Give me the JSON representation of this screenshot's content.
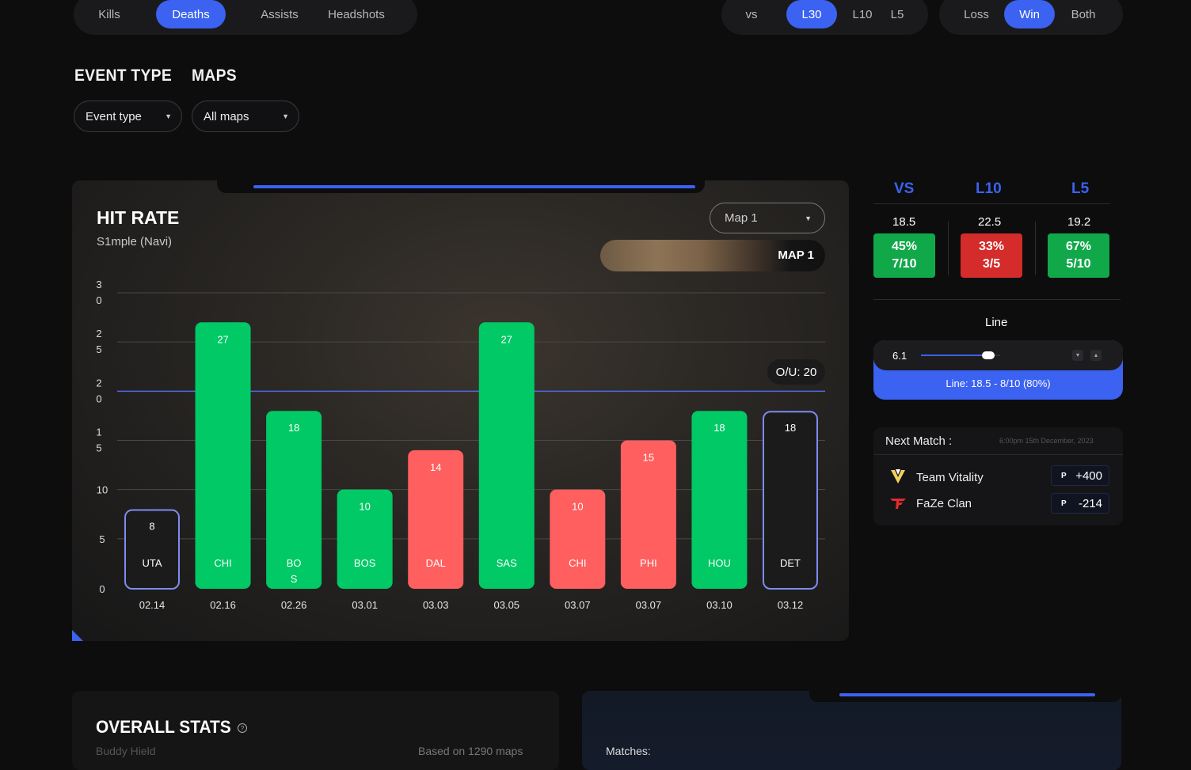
{
  "tabs": {
    "stat": [
      {
        "label": "Kills",
        "active": false
      },
      {
        "label": "Deaths",
        "active": true
      },
      {
        "label": "Assists",
        "active": false
      },
      {
        "label": "Headshots",
        "active": false
      }
    ],
    "range": [
      {
        "label": "vs",
        "active": false
      },
      {
        "label": "L30",
        "active": true
      },
      {
        "label": "L10",
        "active": false
      },
      {
        "label": "L5",
        "active": false
      }
    ],
    "outcome": [
      {
        "label": "Loss",
        "active": false
      },
      {
        "label": "Win",
        "active": true
      },
      {
        "label": "Both",
        "active": false
      }
    ]
  },
  "filters": {
    "event_heading": "EVENT TYPE",
    "maps_heading": "MAPS",
    "event_select": "Event type",
    "maps_select": "All maps"
  },
  "hit_rate": {
    "title": "HIT RATE",
    "subtitle": "S1mple (Navi)",
    "map_select": "Map 1",
    "map_banner": "MAP 1",
    "ou_label": "O/U: 20"
  },
  "chart_data": {
    "type": "bar",
    "categories": [
      "02.14",
      "02.16",
      "02.26",
      "03.01",
      "03.03",
      "03.05",
      "03.07",
      "03.07",
      "03.10",
      "03.12"
    ],
    "opponents": [
      "UTA",
      "CHI",
      "BOS",
      "BOS",
      "DAL",
      "SAS",
      "CHI",
      "PHI",
      "HOU",
      "DET"
    ],
    "values": [
      8,
      27,
      18,
      10,
      14,
      27,
      10,
      15,
      18,
      18
    ],
    "status": [
      "outline",
      "green",
      "green",
      "green",
      "red",
      "green",
      "red",
      "red",
      "green",
      "outline"
    ],
    "ylim": [
      0,
      30
    ],
    "yticks": [
      0,
      5,
      10,
      15,
      20,
      25,
      30
    ],
    "threshold": 20,
    "colors": {
      "green": "#00c965",
      "red": "#ff5f5f",
      "outline": "#7d8cf0"
    }
  },
  "summary": {
    "columns": [
      {
        "label": "VS",
        "line": "18.5",
        "pct": "45%",
        "record": "7/10",
        "color": "#11a84a"
      },
      {
        "label": "L10",
        "line": "22.5",
        "pct": "33%",
        "record": "3/5",
        "color": "#d42b2b"
      },
      {
        "label": "L5",
        "line": "19.2",
        "pct": "67%",
        "record": "5/10",
        "color": "#11a84a"
      }
    ]
  },
  "line": {
    "title": "Line",
    "value": "6.1",
    "slider_fraction": 0.85,
    "result": "Line: 18.5 - 8/10 (80%)"
  },
  "next_match": {
    "title": "Next Match :",
    "time": "6:00pm 15th December, 2023",
    "teams": [
      {
        "name": "Team Vitality",
        "odds": "+400",
        "icon": "vitality-logo"
      },
      {
        "name": "FaZe Clan",
        "odds": "-214",
        "icon": "faze-logo"
      }
    ]
  },
  "overall": {
    "title": "OVERALL STATS",
    "player": "Buddy Hield",
    "based_on": "Based on 1290 maps",
    "matches_label": "Matches:"
  }
}
